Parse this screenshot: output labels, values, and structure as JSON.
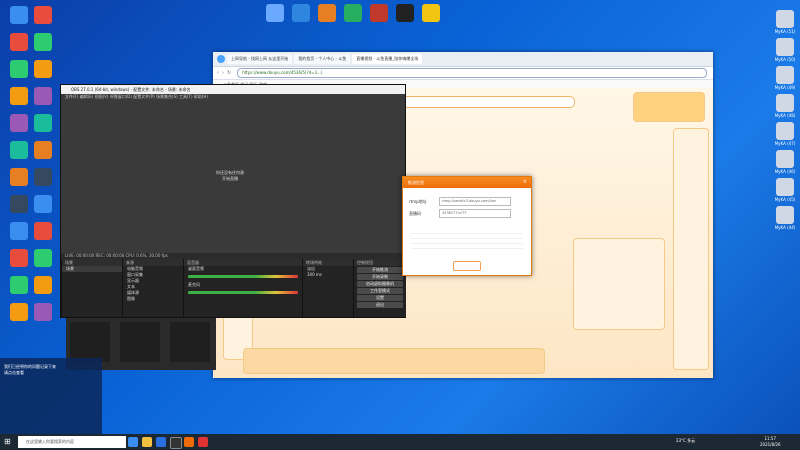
{
  "desktop": {
    "icons_top": [
      {
        "label": "",
        "color": "#6aa9ff"
      },
      {
        "label": "",
        "color": "#2e86de"
      },
      {
        "label": "",
        "color": "#e67e22"
      },
      {
        "label": "",
        "color": "#27ae60"
      },
      {
        "label": "",
        "color": "#c0392b"
      },
      {
        "label": "",
        "color": "#222222"
      },
      {
        "label": "",
        "color": "#f1c40f"
      }
    ],
    "icons_right": [
      {
        "label": "MyKA (51)"
      },
      {
        "label": "MyKA (50)"
      },
      {
        "label": "MyKA (49)"
      },
      {
        "label": "MyKA (48)"
      },
      {
        "label": "MyKA (47)"
      },
      {
        "label": "MyKA (46)"
      },
      {
        "label": "MyKA (45)"
      },
      {
        "label": "MyKA (44)"
      }
    ]
  },
  "browser": {
    "tabs": [
      "上网导航 - 找网上网 从这里开始",
      "我的首页 - 个人中心 - 斗鱼",
      "直播视频 - 斗鱼直播_陪你嗨爆全场"
    ],
    "url": "https://www.douyu.com/4536/5(?d=3...)",
    "bookmarks": "斗鱼首页  热门  娱乐  游戏"
  },
  "obs": {
    "title": "OBS 27.0.1 (64-bit, windows) - 配置文件: 未命名 - 场景: 未命名",
    "menu": "文件(F)  编辑(E)  视图(V)  停靠窗口(D)  配置文件(P)  场景集合(S)  工具(T)  帮助(H)",
    "preview_text": "你还没有任何源\n开始直播",
    "scenes_head": "场景",
    "scenes": [
      "场景"
    ],
    "sources_head": "来源",
    "sources": [
      "电脑音频",
      "窗口采集",
      "显示器",
      "文本",
      "媒体源",
      "图像"
    ],
    "mixer_head": "混音器",
    "mixer": [
      "桌面音频",
      "麦克风"
    ],
    "transitions_head": "转场特效",
    "transitions": [
      "淡出",
      "300 ms"
    ],
    "controls_head": "控制按钮",
    "controls": [
      "开始推流",
      "开始录制",
      "启动虚拟摄像机",
      "工作室模式",
      "设置",
      "退出"
    ],
    "status": "LIVE: 00:00:00   REC: 00:00:00   CPU: 0.6%, 30.00 fps"
  },
  "dialog": {
    "title": "推流信息",
    "rtmp_label": "rtmp地址",
    "rtmp_value": "rtmp://sendtc3.douyu.com/live",
    "code_label": "直播码",
    "code_value": "4536277rz???"
  },
  "notification": {
    "title": "",
    "lines": [
      "我们已经将你的问题记录下来",
      "请点击查看"
    ]
  },
  "taskbar": {
    "search_placeholder": "在这里输入你要搜索的内容",
    "clock": "11:57",
    "date": "2021/8/26",
    "weather": "23°C 多云"
  },
  "colors": {
    "accent": "#ee6d0a",
    "obs_bg": "#2b2b2b",
    "taskbar": "#1c2833"
  }
}
